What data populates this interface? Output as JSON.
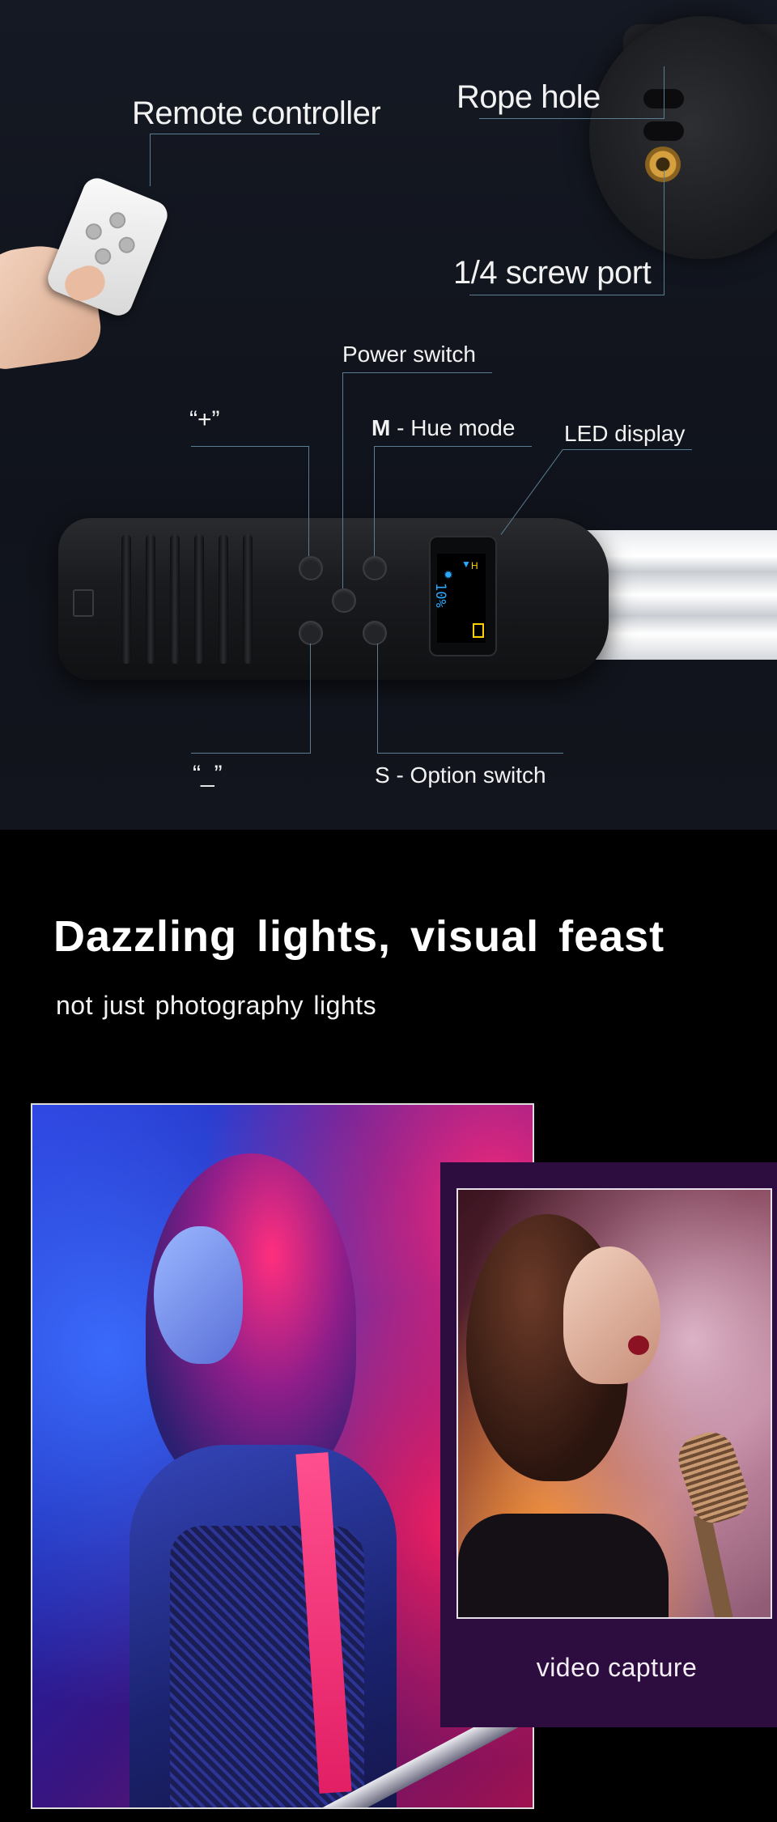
{
  "annotations": {
    "remote_controller": "Remote controller",
    "rope_hole": "Rope hole",
    "screw_port": "1/4 screw port",
    "power_switch": "Power switch",
    "plus": "“+”",
    "hue_mode_key": "M",
    "hue_mode_text": " - Hue mode",
    "led_display": "LED display",
    "minus": "“_”",
    "option_switch": "S - Option switch"
  },
  "screen": {
    "brightness": "10%",
    "icon_sun": "sun-icon",
    "icon_battery": "battery-icon"
  },
  "headline": {
    "title": "Dazzling lights, visual feast",
    "subtitle": "not just photography lights"
  },
  "gallery": {
    "right_caption": "video capture"
  },
  "colors": {
    "annotation_line": "#5a7d93",
    "screen_text": "#2aa9ff",
    "battery": "#ffd200",
    "card_bg": "#2d0c3f"
  }
}
